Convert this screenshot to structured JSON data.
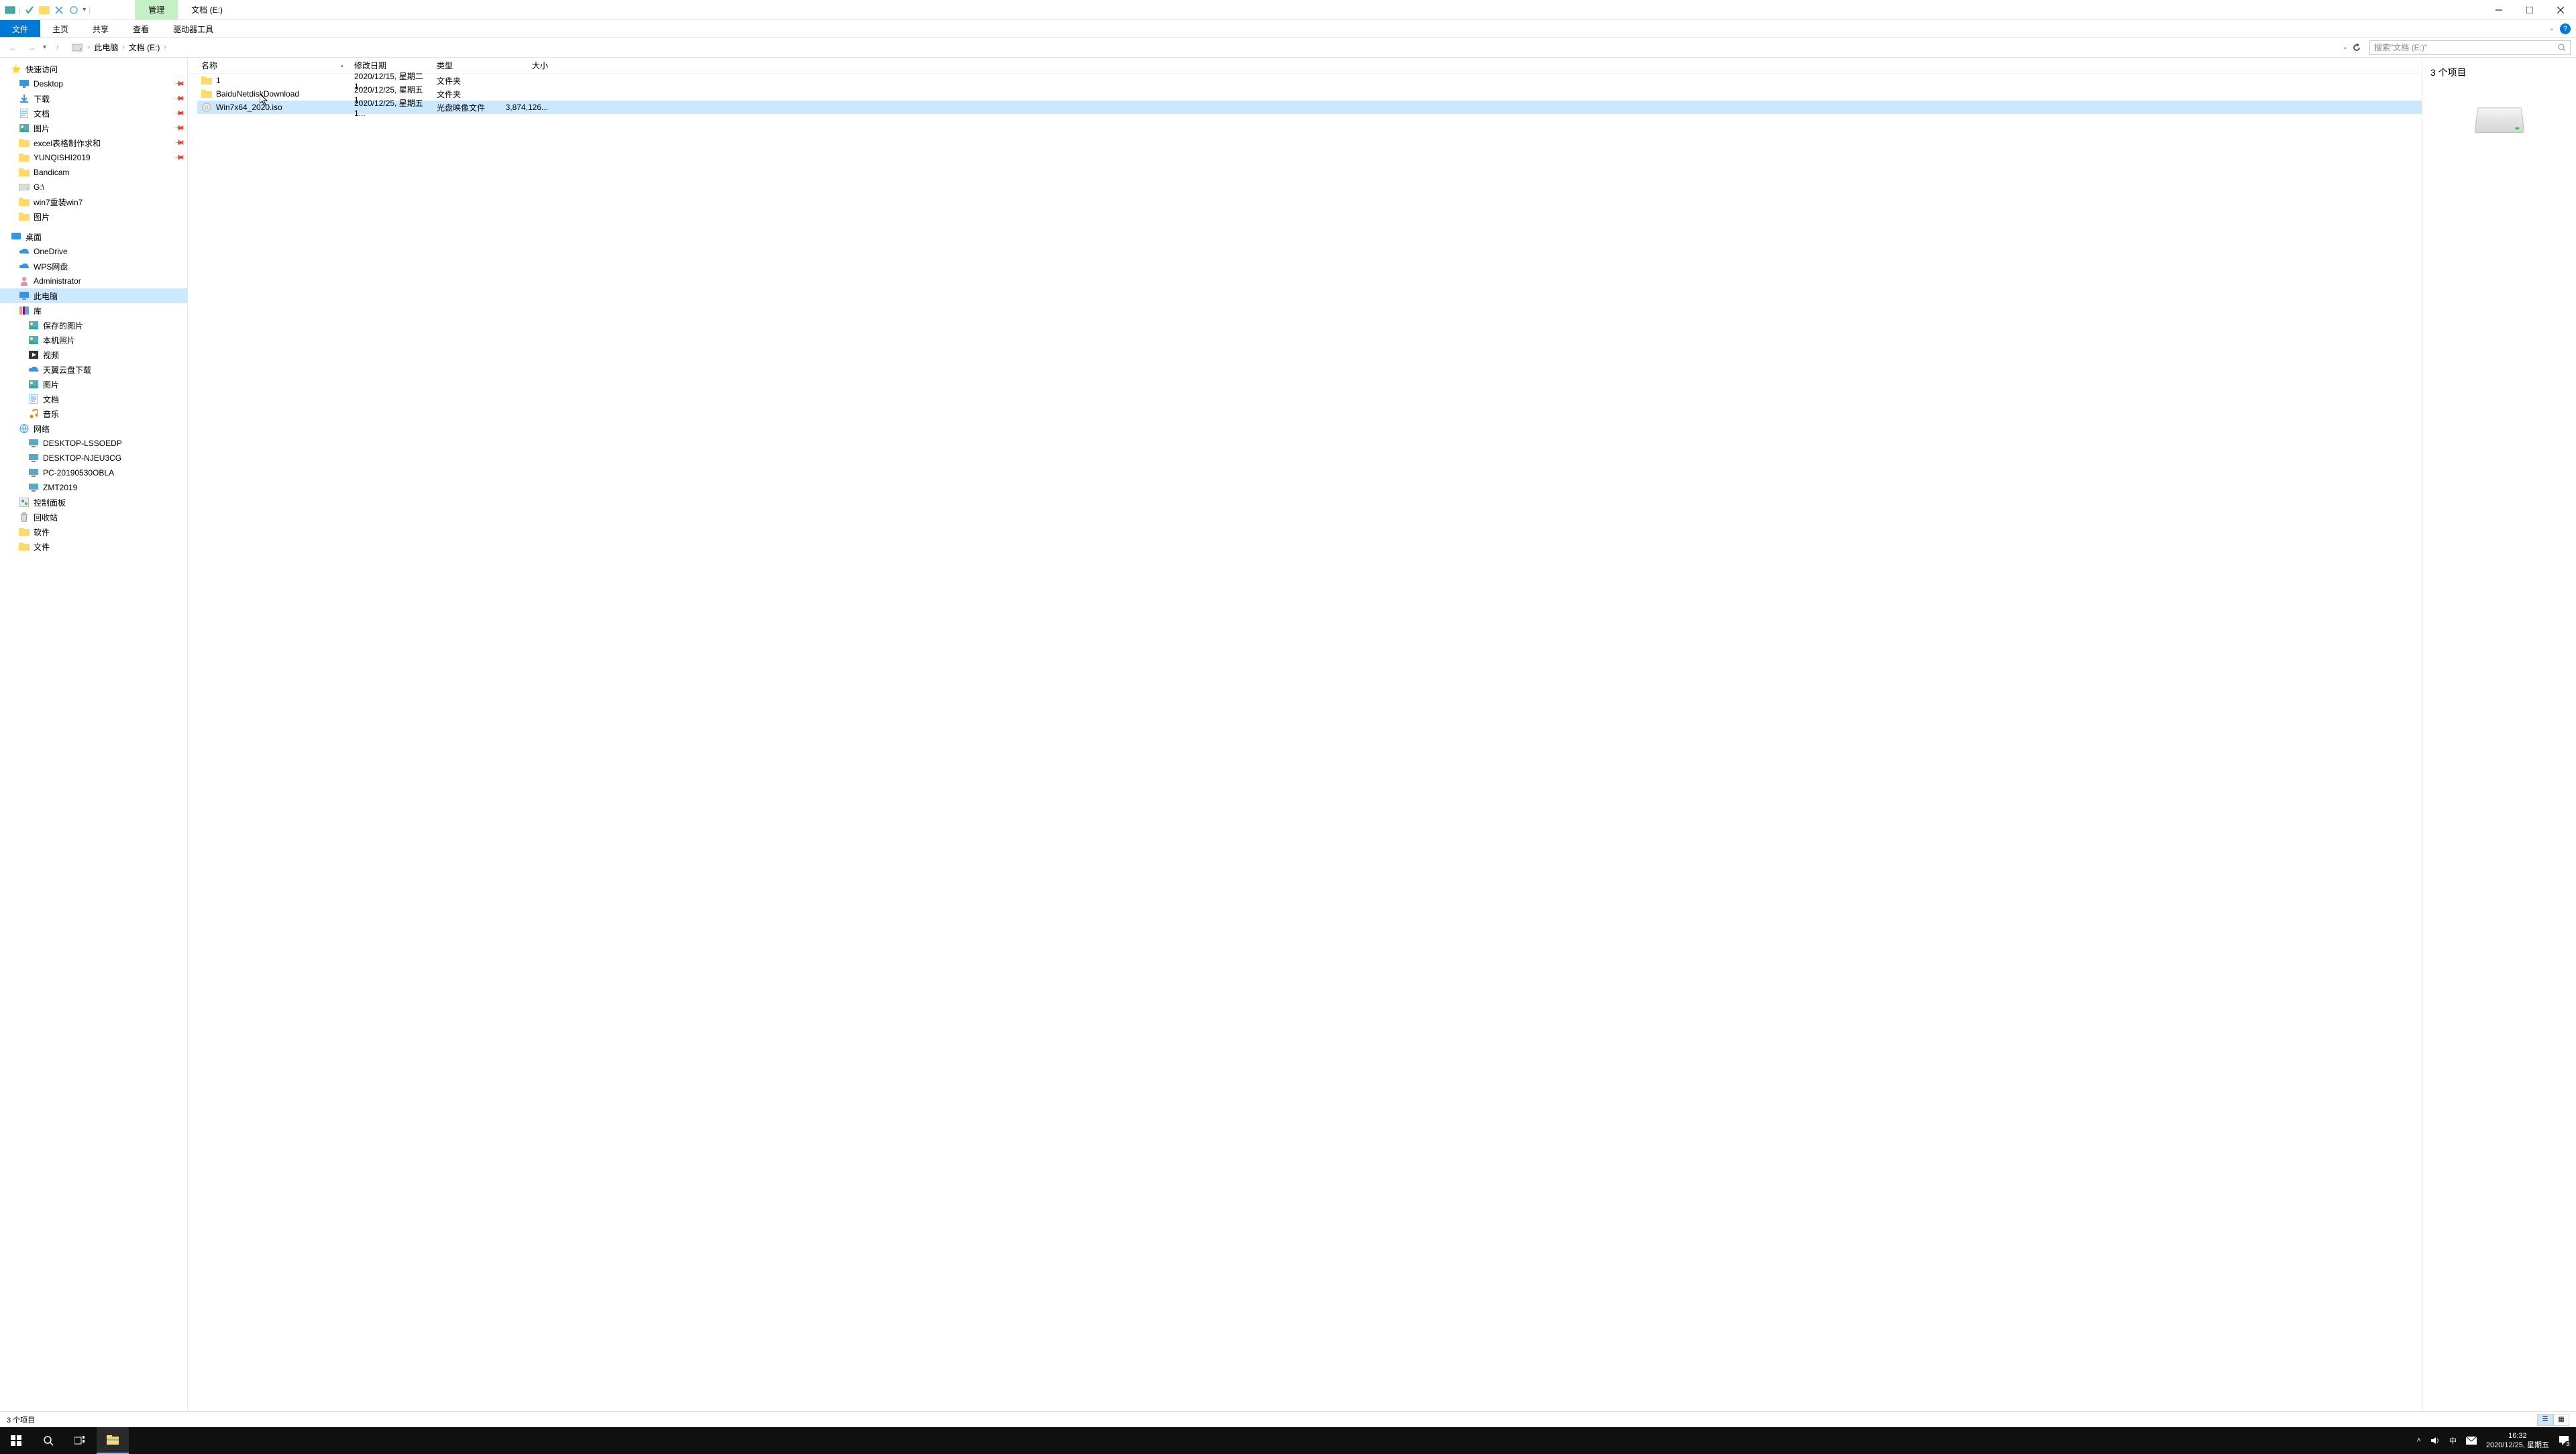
{
  "titlebar": {
    "contextual_tab": "管理",
    "location_tab": "文档 (E:)"
  },
  "ribbon": {
    "file": "文件",
    "home": "主页",
    "share": "共享",
    "view": "查看",
    "drive_tools": "驱动器工具"
  },
  "breadcrumb": {
    "this_pc": "此电脑",
    "drive": "文档 (E:)"
  },
  "search": {
    "placeholder": "搜索\"文档 (E:)\""
  },
  "nav": {
    "quick_access": "快速访问",
    "items_qa": [
      {
        "icon": "desktop",
        "label": "Desktop",
        "pin": true,
        "indent": 28
      },
      {
        "icon": "downloads",
        "label": "下载",
        "pin": true,
        "indent": 28
      },
      {
        "icon": "documents",
        "label": "文档",
        "pin": true,
        "indent": 28
      },
      {
        "icon": "pictures",
        "label": "图片",
        "pin": true,
        "indent": 28
      },
      {
        "icon": "folder",
        "label": "excel表格制作求和",
        "pin": true,
        "indent": 28
      },
      {
        "icon": "folder-brand",
        "label": "YUNQISHI2019",
        "pin": true,
        "indent": 28
      },
      {
        "icon": "folder",
        "label": "Bandicam",
        "pin": false,
        "indent": 28
      },
      {
        "icon": "drive",
        "label": "G:\\",
        "pin": false,
        "indent": 28
      },
      {
        "icon": "folder",
        "label": "win7重装win7",
        "pin": false,
        "indent": 28
      },
      {
        "icon": "folder",
        "label": "图片",
        "pin": false,
        "indent": 28
      }
    ],
    "desktop_section": "桌面",
    "items_desktop": [
      {
        "icon": "onedrive",
        "label": "OneDrive",
        "indent": 28
      },
      {
        "icon": "wps",
        "label": "WPS网盘",
        "indent": 28
      },
      {
        "icon": "user",
        "label": "Administrator",
        "indent": 28
      },
      {
        "icon": "this-pc",
        "label": "此电脑",
        "indent": 28,
        "selected": true
      },
      {
        "icon": "library",
        "label": "库",
        "indent": 28
      },
      {
        "icon": "saved-pictures",
        "label": "保存的图片",
        "indent": 42
      },
      {
        "icon": "camera-roll",
        "label": "本机照片",
        "indent": 42
      },
      {
        "icon": "videos",
        "label": "视频",
        "indent": 42
      },
      {
        "icon": "cloud-dl",
        "label": "天翼云盘下载",
        "indent": 42
      },
      {
        "icon": "pictures",
        "label": "图片",
        "indent": 42
      },
      {
        "icon": "documents",
        "label": "文档",
        "indent": 42
      },
      {
        "icon": "music",
        "label": "音乐",
        "indent": 42
      },
      {
        "icon": "network",
        "label": "网络",
        "indent": 28
      },
      {
        "icon": "computer",
        "label": "DESKTOP-LSSOEDP",
        "indent": 42
      },
      {
        "icon": "computer",
        "label": "DESKTOP-NJEU3CG",
        "indent": 42
      },
      {
        "icon": "computer",
        "label": "PC-20190530OBLA",
        "indent": 42
      },
      {
        "icon": "computer",
        "label": "ZMT2019",
        "indent": 42
      },
      {
        "icon": "control-panel",
        "label": "控制面板",
        "indent": 28
      },
      {
        "icon": "recycle",
        "label": "回收站",
        "indent": 28
      },
      {
        "icon": "folder",
        "label": "软件",
        "indent": 28
      },
      {
        "icon": "folder",
        "label": "文件",
        "indent": 28
      }
    ]
  },
  "columns": {
    "name": "名称",
    "date": "修改日期",
    "type": "类型",
    "size": "大小"
  },
  "files": [
    {
      "icon": "folder",
      "name": "1",
      "date": "2020/12/15, 星期二 1...",
      "type": "文件夹",
      "size": "",
      "selected": false
    },
    {
      "icon": "folder",
      "name": "BaiduNetdiskDownload",
      "date": "2020/12/25, 星期五 1...",
      "type": "文件夹",
      "size": "",
      "selected": false
    },
    {
      "icon": "iso",
      "name": "Win7x64_2020.iso",
      "date": "2020/12/25, 星期五 1...",
      "type": "光盘映像文件",
      "size": "3,874,126...",
      "selected": true
    }
  ],
  "preview": {
    "title": "3 个项目"
  },
  "status": {
    "text": "3 个项目"
  },
  "taskbar": {
    "time": "16:32",
    "date": "2020/12/25, 星期五",
    "ime": "中",
    "notif_count": "3"
  }
}
